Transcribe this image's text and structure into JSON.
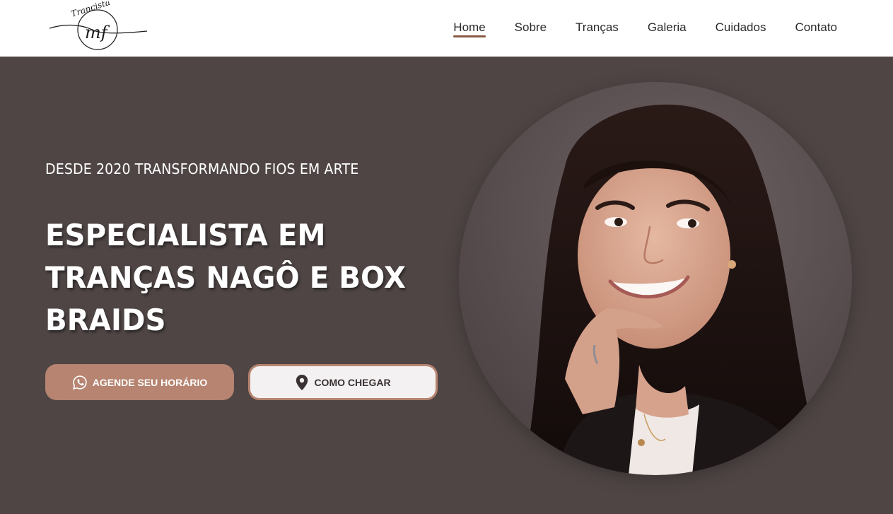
{
  "brand": {
    "logo_script_text": "Trancista",
    "logo_monogram": "mf"
  },
  "nav": {
    "items": [
      {
        "label": "Home",
        "active": true
      },
      {
        "label": "Sobre",
        "active": false
      },
      {
        "label": "Tranças",
        "active": false
      },
      {
        "label": "Galeria",
        "active": false
      },
      {
        "label": "Cuidados",
        "active": false
      },
      {
        "label": "Contato",
        "active": false
      }
    ]
  },
  "hero": {
    "tagline": "DESDE 2020 TRANSFORMANDO FIOS EM ARTE",
    "headline": "ESPECIALISTA EM TRANÇAS NAGÔ E BOX BRAIDS",
    "primary_button": {
      "label": "AGENDE SEU HORÁRIO",
      "icon": "whatsapp-icon"
    },
    "secondary_button": {
      "label": "COMO CHEGAR",
      "icon": "map-pin-icon"
    }
  },
  "colors": {
    "hero_background": "#4f4545",
    "accent": "#b68470",
    "nav_underline": "#8a5a44",
    "navbar_background": "#ffffff"
  }
}
